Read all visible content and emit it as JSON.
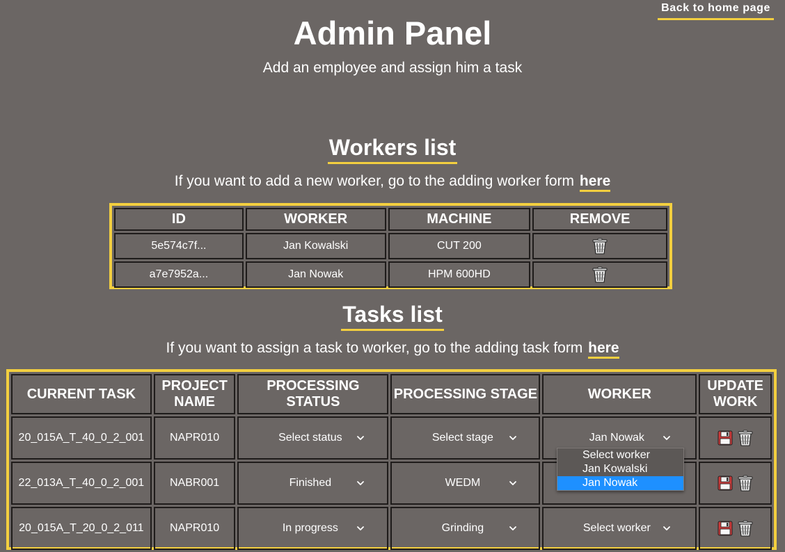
{
  "header": {
    "back_link": "Back to home page",
    "title": "Admin Panel",
    "subtitle": "Add an employee and assign him a task"
  },
  "workers": {
    "title": "Workers list",
    "desc": "If you want to add a new worker, go to the adding worker form ",
    "link": "here",
    "columns": [
      "ID",
      "WORKER",
      "MACHINE",
      "REMOVE"
    ],
    "rows": [
      {
        "id": "5e574c7f...",
        "worker": "Jan Kowalski",
        "machine": "CUT 200"
      },
      {
        "id": "a7e7952a...",
        "worker": "Jan Nowak",
        "machine": "HPM 600HD"
      }
    ]
  },
  "tasks": {
    "title": "Tasks list",
    "desc": "If you want to assign a task to worker, go to the adding task form ",
    "link": "here",
    "columns": [
      "CURRENT TASK",
      "PROJECT NAME",
      "PROCESSING STATUS",
      "PROCESSING STAGE",
      "WORKER",
      "UPDATE WORK"
    ],
    "rows": [
      {
        "task": "20_015A_T_40_0_2_001",
        "project": "NAPR010",
        "status": "Select status",
        "stage": "Select stage",
        "worker": "Jan Nowak"
      },
      {
        "task": "22_013A_T_40_0_2_001",
        "project": "NABR001",
        "status": "Finished",
        "stage": "WEDM",
        "worker": ""
      },
      {
        "task": "20_015A_T_20_0_2_011",
        "project": "NAPR010",
        "status": "In progress",
        "stage": "Grinding",
        "worker": "Select worker"
      }
    ]
  },
  "worker_dropdown": {
    "options": [
      "Select worker",
      "Jan Kowalski",
      "Jan Nowak"
    ],
    "highlighted": "Jan Nowak",
    "highlight_color": "#1e90ff"
  },
  "colors": {
    "background": "#6b6664",
    "accent": "#f3cf3f",
    "cell_border": "#1f1c1b"
  },
  "icons": {
    "remove": "trash-icon",
    "save": "floppy-disk-icon",
    "delete": "trash-icon",
    "select": "chevron-down-icon"
  }
}
